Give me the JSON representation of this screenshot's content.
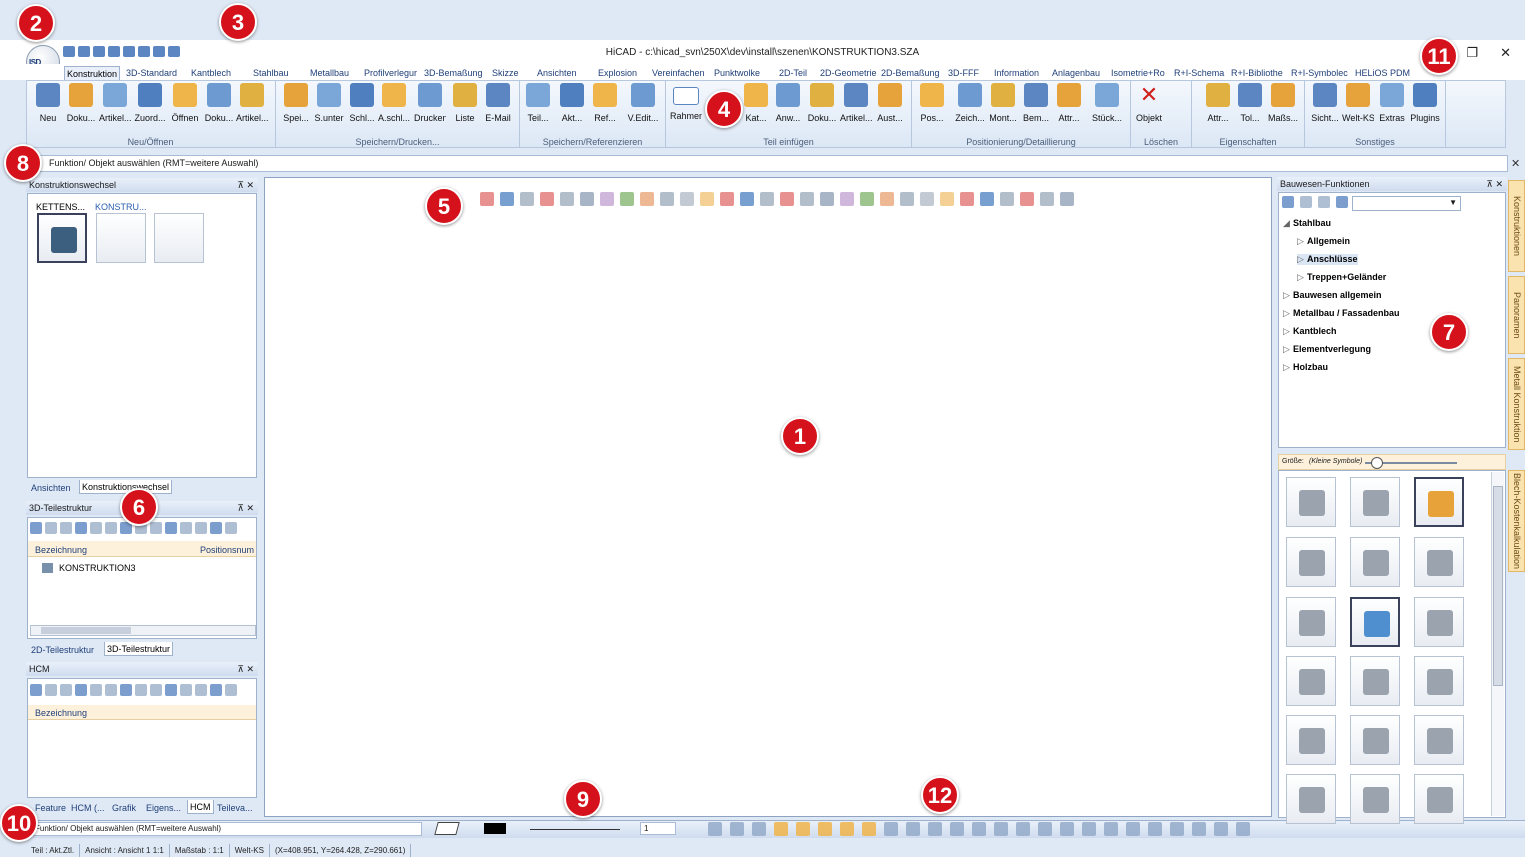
{
  "window": {
    "title": "HiCAD - c:\\hicad_svn\\250X\\dev\\install\\szenen\\KONSTRUKTION3.SZA",
    "logo_text": "ISD"
  },
  "ribbon_tabs": [
    "Konstruktion",
    "3D-Standard",
    "Kantblech",
    "Stahlbau",
    "Metallbau",
    "Profilverlegur",
    "3D-Bemaßung",
    "Skizze",
    "Ansichten",
    "Explosion",
    "Vereinfachen",
    "Punktwolke",
    "2D-Teil",
    "2D-Geometrie",
    "2D-Bemaßung",
    "3D-FFF",
    "Information",
    "Anlagenbau",
    "Isometrie+Ro",
    "R+I-Schema",
    "R+I-Bibliothe",
    "R+I-Symbolec",
    "HELiOS PDM"
  ],
  "ribbon_groups": [
    {
      "label": "Neu/Öffnen",
      "buttons": [
        "Neu",
        "Doku...",
        "Artikel...",
        "Zuord...",
        "Öffnen",
        "Doku...",
        "Artikel..."
      ]
    },
    {
      "label": "Speichern/Drucken...",
      "buttons": [
        "Spei...",
        "S.unter",
        "Schl...",
        "A.schl...",
        "Drucken",
        "Liste",
        "E-Mail"
      ]
    },
    {
      "label": "Speichern/Referenzieren",
      "buttons": [
        "Teil...",
        "Akt...",
        "Ref...",
        "V.Edit..."
      ]
    },
    {
      "label": "Teil einfügen",
      "buttons": [
        "Rahmen",
        "Kat...",
        "Anw...",
        "Doku...",
        "Artikel...",
        "Aust..."
      ]
    },
    {
      "label": "Positionierung/Detaillierung",
      "buttons": [
        "Pos...",
        "Zeich...",
        "Mont...",
        "Bem...",
        "Attr...",
        "Stück..."
      ]
    },
    {
      "label": "Löschen",
      "buttons": [
        "Objekt"
      ]
    },
    {
      "label": "Eigenschaften",
      "buttons": [
        "Attr...",
        "Tol...",
        "Maßs..."
      ]
    },
    {
      "label": "Sonstiges",
      "buttons": [
        "Sicht...",
        "Welt-KS",
        "Extras",
        "Plugins"
      ]
    }
  ],
  "cmdbar": {
    "prompt": "Funktion/ Objekt auswählen (RMT=weitere Auswahl)"
  },
  "konstruktionswechsel": {
    "title": "Konstruktionswechsel",
    "items": [
      "KETTENS...",
      "KONSTRU..."
    ],
    "tabs": [
      "Ansichten",
      "Konstruktionswechsel"
    ]
  },
  "teilestruktur": {
    "title": "3D-Teilestruktur",
    "col_bezeichnung": "Bezeichnung",
    "col_position": "Positionsnum",
    "row": "KONSTRUKTION3",
    "tabs": [
      "2D-Teilestruktur",
      "3D-Teilestruktur"
    ]
  },
  "hcm": {
    "title": "HCM",
    "col_bezeichnung": "Bezeichnung",
    "tabs": [
      "Feature",
      "HCM (...",
      "Grafik",
      "Eigens...",
      "HCM",
      "Teileva..."
    ]
  },
  "bauwesen": {
    "title": "Bauwesen-Funktionen",
    "tree": [
      {
        "label": "Stahlbau",
        "level": 0,
        "arrow": "◢"
      },
      {
        "label": "Allgemein",
        "level": 1,
        "arrow": "▷"
      },
      {
        "label": "Anschlüsse",
        "level": 1,
        "arrow": "▷",
        "selected": true
      },
      {
        "label": "Treppen+Geländer",
        "level": 1,
        "arrow": "▷"
      },
      {
        "label": "Bauwesen allgemein",
        "level": 0,
        "arrow": "▷"
      },
      {
        "label": "Metallbau / Fassadenbau",
        "level": 0,
        "arrow": "▷"
      },
      {
        "label": "Kantblech",
        "level": 0,
        "arrow": "▷"
      },
      {
        "label": "Elementverlegung",
        "level": 0,
        "arrow": "▷"
      },
      {
        "label": "Holzbau",
        "level": 0,
        "arrow": "▷"
      }
    ],
    "size_label": "Größe:",
    "size_value": "(Kleine Symbole)"
  },
  "side_tabs": [
    "Konstruktionen",
    "Panoramen",
    "Metall Konstruktion",
    "Blech-Kostenkalkulation"
  ],
  "bottombar": {
    "prompt": "Funktion/ Objekt auswählen (RMT=weitere Auswahl)",
    "line_width": "1"
  },
  "status": [
    "Teil : Akt.Ztl.",
    "Ansicht : Ansicht 1 1:1",
    "Maßstab : 1:1",
    "Welt-KS",
    "(X=408.951, Y=264.428, Z=290.661)"
  ],
  "callouts": [
    "1",
    "2",
    "3",
    "4",
    "5",
    "6",
    "7",
    "8",
    "9",
    "10",
    "11",
    "12"
  ],
  "colors": {
    "accent": "#d5121b",
    "ribbon_bg": "#dce7f5",
    "side_tab": "#fbe3b0"
  }
}
